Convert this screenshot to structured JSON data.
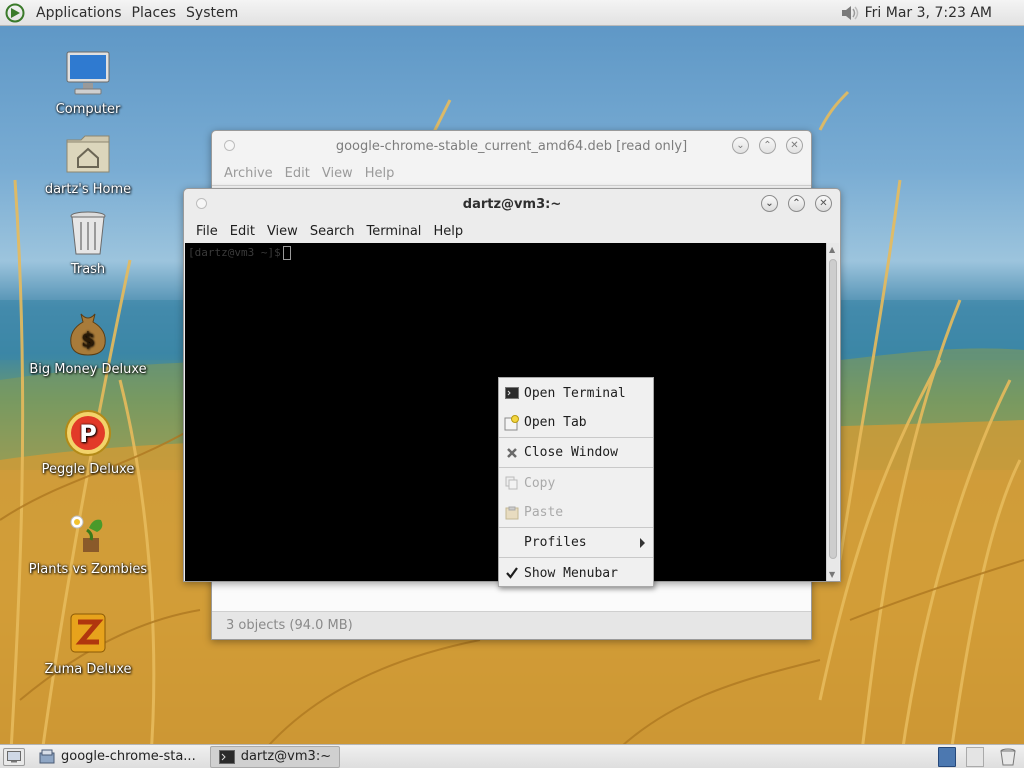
{
  "top_panel": {
    "menus": [
      "Applications",
      "Places",
      "System"
    ],
    "clock": "Fri Mar  3,  7:23 AM"
  },
  "desktop": {
    "icons": [
      {
        "label": "Computer",
        "icon": "computer-icon"
      },
      {
        "label": "dartz's Home",
        "icon": "home-folder-icon"
      },
      {
        "label": "Trash",
        "icon": "trash-icon"
      },
      {
        "label": "Big Money Deluxe",
        "icon": "money-bag-icon"
      },
      {
        "label": "Peggle Deluxe",
        "icon": "peggle-icon"
      },
      {
        "label": "Plants vs Zombies",
        "icon": "plants-icon"
      },
      {
        "label": "Zuma Deluxe",
        "icon": "zuma-icon"
      }
    ]
  },
  "archive_window": {
    "title": "google-chrome-stable_current_amd64.deb [read only]",
    "menus": [
      "Archive",
      "Edit",
      "View",
      "Help"
    ],
    "status": "3 objects (94.0 MB)"
  },
  "terminal_window": {
    "title": "dartz@vm3:~",
    "menus": [
      "File",
      "Edit",
      "View",
      "Search",
      "Terminal",
      "Help"
    ],
    "prompt": "[dartz@vm3 ~]$"
  },
  "context_menu": {
    "items": [
      {
        "label": "Open Terminal",
        "icon": "terminal-icon",
        "disabled": false
      },
      {
        "label": "Open Tab",
        "icon": "new-tab-icon",
        "disabled": false
      },
      {
        "label": "Close Window",
        "icon": "close-icon",
        "disabled": false
      },
      {
        "label": "Copy",
        "icon": "copy-icon",
        "disabled": true
      },
      {
        "label": "Paste",
        "icon": "paste-icon",
        "disabled": true
      },
      {
        "label": "Profiles",
        "icon": "",
        "disabled": false,
        "submenu": true
      },
      {
        "label": "Show Menubar",
        "icon": "check-icon",
        "disabled": false,
        "checked": true
      }
    ]
  },
  "bottom_panel": {
    "tasks": [
      {
        "label": "google-chrome-sta...",
        "icon": "archive-manager-icon",
        "active": false
      },
      {
        "label": "dartz@vm3:~",
        "icon": "terminal-icon",
        "active": true
      }
    ]
  },
  "colors": {
    "panel": "#e8e8e8",
    "terminal_bg": "#000000",
    "workspace_active": "#4c78b0"
  }
}
